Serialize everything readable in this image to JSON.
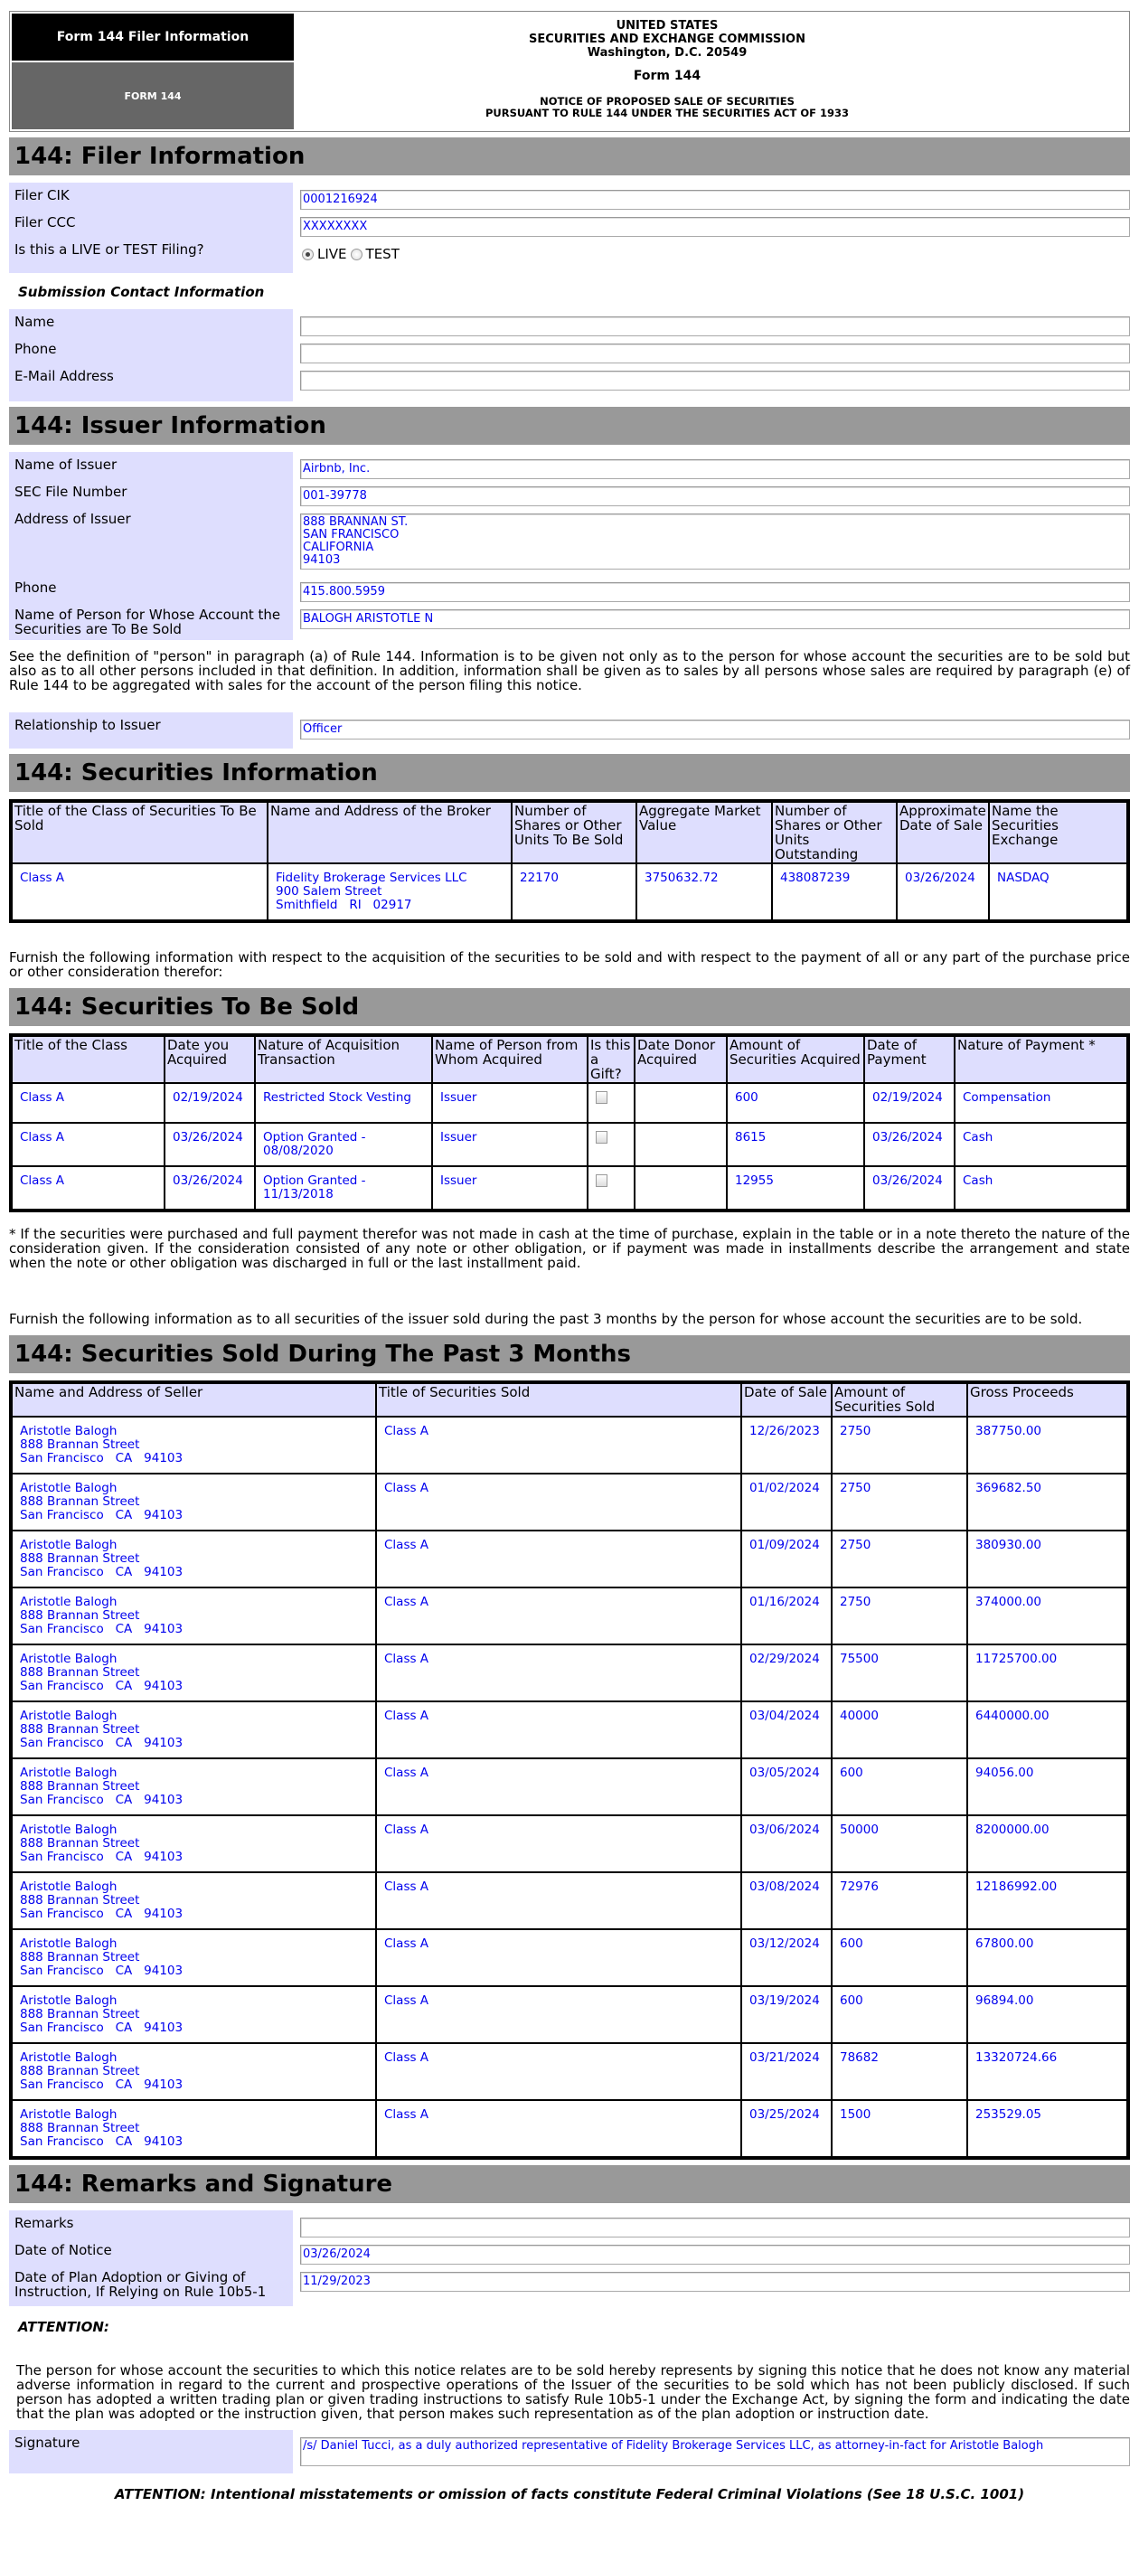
{
  "header": {
    "filer_info_tab": "Form 144 Filer Information",
    "form_tab": "FORM 144",
    "agency_line1": "UNITED STATES",
    "agency_line2": "SECURITIES AND EXCHANGE COMMISSION",
    "agency_line3": "Washington, D.C. 20549",
    "form_title": "Form 144",
    "notice_line1": "NOTICE OF PROPOSED SALE OF SECURITIES",
    "notice_line2": "PURSUANT TO RULE 144 UNDER THE SECURITIES ACT OF 1933"
  },
  "filer": {
    "section_title": "144: Filer Information",
    "cik_label": "Filer CIK",
    "cik_value": "0001216924",
    "ccc_label": "Filer CCC",
    "ccc_value": "XXXXXXXX",
    "live_test_label": "Is this a LIVE or TEST Filing?",
    "live_option": "LIVE",
    "test_option": "TEST",
    "selected_option": "LIVE",
    "contact_heading": "Submission Contact Information",
    "name_label": "Name",
    "name_value": "",
    "phone_label": "Phone",
    "phone_value": "",
    "email_label": "E-Mail Address",
    "email_value": ""
  },
  "issuer": {
    "section_title": "144: Issuer Information",
    "name_label": "Name of Issuer",
    "name_value": "Airbnb, Inc.",
    "file_number_label": "SEC File Number",
    "file_number_value": "001-39778",
    "address_label": "Address of Issuer",
    "address_lines": [
      "888 BRANNAN ST.",
      "SAN FRANCISCO",
      "CALIFORNIA",
      "94103"
    ],
    "phone_label": "Phone",
    "phone_value": "415.800.5959",
    "person_label": "Name of Person for Whose Account the Securities are To Be Sold",
    "person_value": "BALOGH ARISTOTLE N",
    "definition_note": "See the definition of \"person\" in paragraph (a) of Rule 144. Information is to be given not only as to the person for whose account the securities are to be sold but also as to all other persons included in that definition. In addition, information shall be given as to sales by all persons whose sales are required by paragraph (e) of Rule 144 to be aggregated with sales for the account of the person filing this notice.",
    "relationship_label": "Relationship to Issuer",
    "relationship_value": "Officer"
  },
  "securities_info": {
    "section_title": "144: Securities Information",
    "columns": [
      "Title of the Class of Securities To Be Sold",
      "Name and Address of the Broker",
      "Number of Shares or Other Units To Be Sold",
      "Aggregate Market Value",
      "Number of Shares or Other Units Outstanding",
      "Approximate Date of Sale",
      "Name the Securities Exchange"
    ],
    "rows": [
      {
        "class": "Class A",
        "broker_lines": [
          "Fidelity Brokerage Services LLC",
          "900 Salem Street",
          "Smithfield   RI   02917"
        ],
        "units_to_be_sold": "22170",
        "aggregate_market_value": "3750632.72",
        "units_outstanding": "438087239",
        "approx_date_of_sale": "03/26/2024",
        "exchange": "NASDAQ"
      }
    ],
    "furnish_note": "Furnish the following information with respect to the acquisition of the securities to be sold and with respect to the payment of all or any part of the purchase price or other consideration therefor:"
  },
  "securities_to_be_sold": {
    "section_title": "144: Securities To Be Sold",
    "columns": [
      "Title of the Class",
      "Date you Acquired",
      "Nature of Acquisition Transaction",
      "Name of Person from Whom Acquired",
      "Is this a Gift?",
      "Date Donor Acquired",
      "Amount of Securities Acquired",
      "Date of Payment",
      "Nature of Payment *"
    ],
    "rows": [
      {
        "class": "Class A",
        "date_acquired": "02/19/2024",
        "nature": "Restricted Stock Vesting",
        "from_whom": "Issuer",
        "is_gift": false,
        "donor_date": "",
        "amount": "600",
        "date_of_payment": "02/19/2024",
        "payment_nature": "Compensation"
      },
      {
        "class": "Class A",
        "date_acquired": "03/26/2024",
        "nature": "Option Granted - 08/08/2020",
        "from_whom": "Issuer",
        "is_gift": false,
        "donor_date": "",
        "amount": "8615",
        "date_of_payment": "03/26/2024",
        "payment_nature": "Cash"
      },
      {
        "class": "Class A",
        "date_acquired": "03/26/2024",
        "nature": "Option Granted - 11/13/2018",
        "from_whom": "Issuer",
        "is_gift": false,
        "donor_date": "",
        "amount": "12955",
        "date_of_payment": "03/26/2024",
        "payment_nature": "Cash"
      }
    ],
    "footnote": "* If the securities were purchased and full payment therefor was not made in cash at the time of purchase, explain in the table or in a note thereto the nature of the consideration given. If the consideration consisted of any note or other obligation, or if payment was made in installments describe the arrangement and state when the note or other obligation was discharged in full or the last installment paid.",
    "past_note": "Furnish the following information as to all securities of the issuer sold during the past 3 months by the person for whose account the securities are to be sold."
  },
  "sold_past_3_months": {
    "section_title": "144: Securities Sold During The Past 3 Months",
    "columns": [
      "Name and Address of Seller",
      "Title of Securities Sold",
      "Date of Sale",
      "Amount of Securities Sold",
      "Gross Proceeds"
    ],
    "rows": [
      {
        "seller_lines": [
          "Aristotle Balogh",
          "888 Brannan Street",
          "San Francisco   CA   94103"
        ],
        "title": "Class A",
        "date": "12/26/2023",
        "amount": "2750",
        "proceeds": "387750.00"
      },
      {
        "seller_lines": [
          "Aristotle Balogh",
          "888 Brannan Street",
          "San Francisco   CA   94103"
        ],
        "title": "Class A",
        "date": "01/02/2024",
        "amount": "2750",
        "proceeds": "369682.50"
      },
      {
        "seller_lines": [
          "Aristotle Balogh",
          "888 Brannan Street",
          "San Francisco   CA   94103"
        ],
        "title": "Class A",
        "date": "01/09/2024",
        "amount": "2750",
        "proceeds": "380930.00"
      },
      {
        "seller_lines": [
          "Aristotle Balogh",
          "888 Brannan Street",
          "San Francisco   CA   94103"
        ],
        "title": "Class A",
        "date": "01/16/2024",
        "amount": "2750",
        "proceeds": "374000.00"
      },
      {
        "seller_lines": [
          "Aristotle Balogh",
          "888 Brannan Street",
          "San Francisco   CA   94103"
        ],
        "title": "Class A",
        "date": "02/29/2024",
        "amount": "75500",
        "proceeds": "11725700.00"
      },
      {
        "seller_lines": [
          "Aristotle Balogh",
          "888 Brannan Street",
          "San Francisco   CA   94103"
        ],
        "title": "Class A",
        "date": "03/04/2024",
        "amount": "40000",
        "proceeds": "6440000.00"
      },
      {
        "seller_lines": [
          "Aristotle Balogh",
          "888 Brannan Street",
          "San Francisco   CA   94103"
        ],
        "title": "Class A",
        "date": "03/05/2024",
        "amount": "600",
        "proceeds": "94056.00"
      },
      {
        "seller_lines": [
          "Aristotle Balogh",
          "888 Brannan Street",
          "San Francisco   CA   94103"
        ],
        "title": "Class A",
        "date": "03/06/2024",
        "amount": "50000",
        "proceeds": "8200000.00"
      },
      {
        "seller_lines": [
          "Aristotle Balogh",
          "888 Brannan Street",
          "San Francisco   CA   94103"
        ],
        "title": "Class A",
        "date": "03/08/2024",
        "amount": "72976",
        "proceeds": "12186992.00"
      },
      {
        "seller_lines": [
          "Aristotle Balogh",
          "888 Brannan Street",
          "San Francisco   CA   94103"
        ],
        "title": "Class A",
        "date": "03/12/2024",
        "amount": "600",
        "proceeds": "67800.00"
      },
      {
        "seller_lines": [
          "Aristotle Balogh",
          "888 Brannan Street",
          "San Francisco   CA   94103"
        ],
        "title": "Class A",
        "date": "03/19/2024",
        "amount": "600",
        "proceeds": "96894.00"
      },
      {
        "seller_lines": [
          "Aristotle Balogh",
          "888 Brannan Street",
          "San Francisco   CA   94103"
        ],
        "title": "Class A",
        "date": "03/21/2024",
        "amount": "78682",
        "proceeds": "13320724.66"
      },
      {
        "seller_lines": [
          "Aristotle Balogh",
          "888 Brannan Street",
          "San Francisco   CA   94103"
        ],
        "title": "Class A",
        "date": "03/25/2024",
        "amount": "1500",
        "proceeds": "253529.05"
      }
    ]
  },
  "remarks": {
    "section_title": "144: Remarks and Signature",
    "remarks_label": "Remarks",
    "remarks_value": "",
    "date_of_notice_label": "Date of Notice",
    "date_of_notice_value": "03/26/2024",
    "plan_adoption_label": "Date of Plan Adoption or Giving of Instruction, If Relying on Rule 10b5-1",
    "plan_adoption_value": "11/29/2023",
    "attention_heading": "ATTENTION:",
    "attention_text": "The person for whose account the securities to which this notice relates are to be sold hereby represents by signing this notice that he does not know any material adverse information in regard to the current and prospective operations of the Issuer of the securities to be sold which has not been publicly disclosed. If such person has adopted a written trading plan or given trading instructions to satisfy Rule 10b5-1 under the Exchange Act, by signing the form and indicating the date that the plan was adopted or the instruction given, that person makes such representation as of the plan adoption or instruction date.",
    "signature_label": "Signature",
    "signature_value": "/s/ Daniel Tucci, as a duly authorized representative of Fidelity Brokerage Services LLC, as attorney-in-fact for Aristotle Balogh",
    "footer_warning": "ATTENTION: Intentional misstatements or omission of facts constitute Federal Criminal Violations (See 18 U.S.C. 1001)"
  }
}
